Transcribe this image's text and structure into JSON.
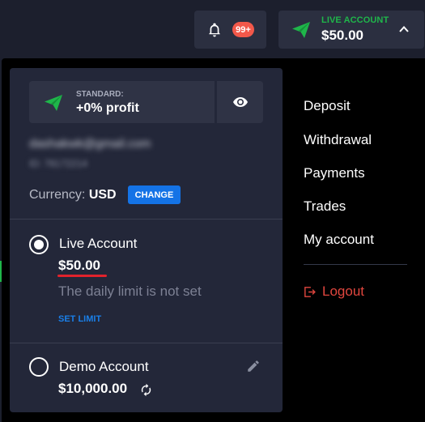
{
  "topbar": {
    "notifications_badge": "99+",
    "account_label": "LIVE ACCOUNT",
    "account_balance": "$50.00"
  },
  "card": {
    "tier_label": "STANDARD:",
    "tier_profit": "+0% profit",
    "email": "dashakwk@gmail.com",
    "account_id": "ID: 78172214",
    "currency_label": "Currency:",
    "currency_value": "USD",
    "change_label": "CHANGE",
    "live": {
      "name": "Live Account",
      "balance": "$50.00",
      "limit_text": "The daily limit is not set",
      "set_limit_label": "SET LIMIT"
    },
    "demo": {
      "name": "Demo Account",
      "balance": "$10,000.00"
    }
  },
  "menu": {
    "items": [
      "Deposit",
      "Withdrawal",
      "Payments",
      "Trades",
      "My account"
    ],
    "logout": "Logout"
  },
  "colors": {
    "accent_green": "#1fb64a",
    "accent_blue": "#1473e6",
    "logout_red": "#e0463e",
    "badge_red": "#f2584a"
  }
}
